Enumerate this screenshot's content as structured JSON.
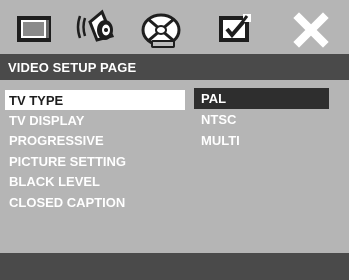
{
  "toolbar": {
    "icons": [
      {
        "name": "general-setup-icon"
      },
      {
        "name": "audio-setup-icon"
      },
      {
        "name": "video-setup-icon",
        "active": true
      },
      {
        "name": "preference-setup-icon"
      },
      {
        "name": "exit-icon"
      }
    ]
  },
  "header": {
    "title": "VIDEO SETUP PAGE"
  },
  "menu": {
    "items": [
      {
        "label": "TV TYPE",
        "selected": true
      },
      {
        "label": "TV DISPLAY"
      },
      {
        "label": "PROGRESSIVE"
      },
      {
        "label": "PICTURE SETTING"
      },
      {
        "label": "BLACK LEVEL"
      },
      {
        "label": "CLOSED CAPTION"
      }
    ]
  },
  "options": {
    "items": [
      {
        "label": "PAL",
        "selected": true
      },
      {
        "label": "NTSC"
      },
      {
        "label": "MULTI"
      }
    ]
  },
  "colors": {
    "background": "#b5b5b5",
    "header": "#4a4a4a",
    "highlight": "#ffffff",
    "option_highlight": "#2e2e2e"
  }
}
